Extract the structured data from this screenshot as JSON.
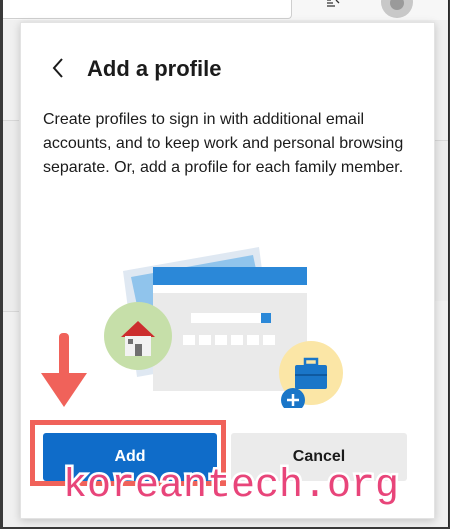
{
  "dialog": {
    "title": "Add a profile",
    "description": "Create profiles to sign in with additional email accounts, and to keep work and personal browsing separate. Or, add a profile for each family member.",
    "add_label": "Add",
    "cancel_label": "Cancel"
  },
  "watermark": {
    "text": "koreantech.org"
  },
  "colors": {
    "accent": "#0f6cc9",
    "annotation_red": "#f0625a",
    "watermark_pink": "#e8457a"
  },
  "icons": {
    "back": "chevron-left-icon",
    "favorites": "favorites-icon",
    "profile": "avatar",
    "house": "house-icon",
    "briefcase": "briefcase-icon",
    "plus": "plus-icon",
    "arrow": "arrow-down-icon"
  }
}
